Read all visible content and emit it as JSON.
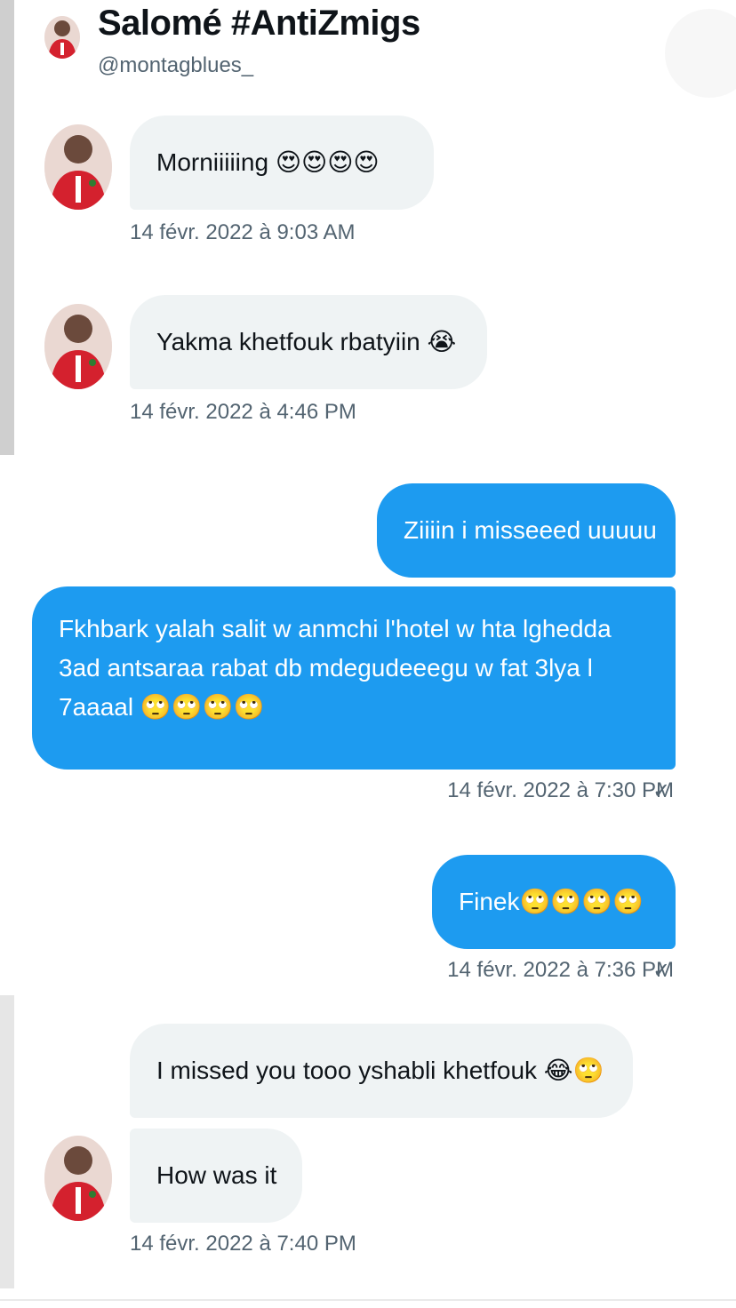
{
  "header": {
    "name": "Salomé #AntiZmigs",
    "handle": "@montagblues_"
  },
  "messages": [
    {
      "sender": "them",
      "text": "Morniiiiing 😍😍😍😍",
      "timestamp": "14 févr. 2022 à 9:03 AM"
    },
    {
      "sender": "them",
      "text": "Yakma khetfouk rbatyiin 😭",
      "timestamp": "14 févr. 2022 à 4:46 PM"
    },
    {
      "sender": "me",
      "text": "Ziiiin i misseeed uuuuu"
    },
    {
      "sender": "me",
      "text": "Fkhbark yalah salit w anmchi l'hotel w hta lghedda 3ad antsaraa rabat db mdegudeeegu w fat 3lya l 7aaaal 🙄🙄🙄🙄",
      "timestamp": "14 févr. 2022 à 7:30 PM",
      "status": "✓"
    },
    {
      "sender": "me",
      "text": "Finek🙄🙄🙄🙄",
      "timestamp": "14 févr. 2022 à 7:36 PM",
      "status": "✓"
    },
    {
      "sender": "them",
      "text": "I missed you tooo yshabli khetfouk 😂🙄"
    },
    {
      "sender": "them",
      "text": "How was it",
      "timestamp": "14 févr. 2022 à 7:40 PM"
    }
  ],
  "colors": {
    "outgoing_bubble": "#1d9bf0",
    "incoming_bubble": "#eff3f4",
    "timestamp": "#536471"
  }
}
